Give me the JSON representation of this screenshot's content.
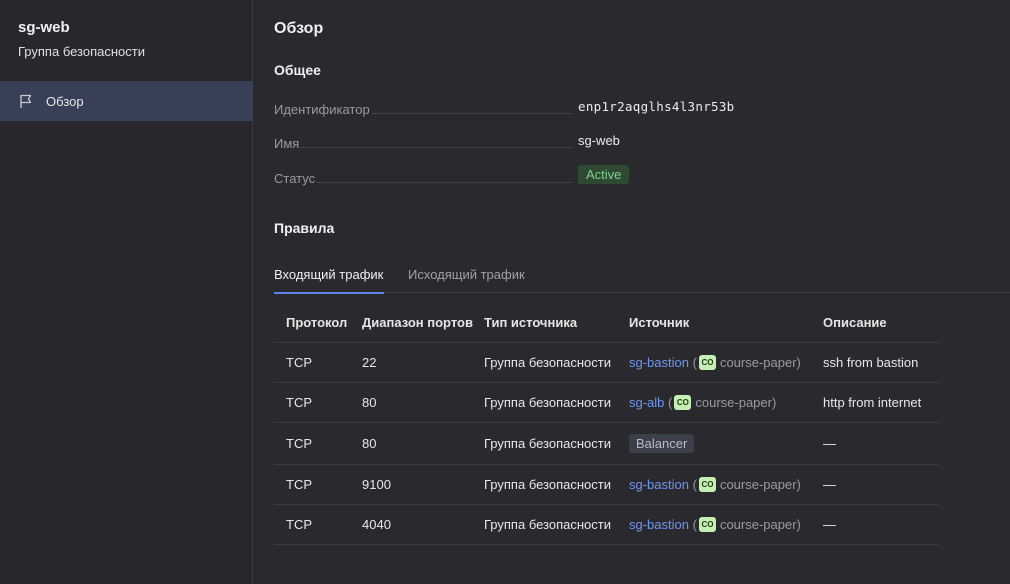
{
  "sidebar": {
    "title": "sg-web",
    "subtitle": "Группа безопасности",
    "items": [
      {
        "label": "Обзор",
        "icon": "flag-icon",
        "active": true
      }
    ]
  },
  "main": {
    "page_title": "Обзор",
    "general": {
      "title": "Общее",
      "id_label": "Идентификатор",
      "id_value": "enp1r2aqglhs4l3nr53b",
      "name_label": "Имя",
      "name_value": "sg-web",
      "status_label": "Статус",
      "status_value": "Active"
    },
    "rules": {
      "title": "Правила",
      "tabs": [
        {
          "label": "Входящий трафик",
          "active": true
        },
        {
          "label": "Исходящий трафик",
          "active": false
        }
      ],
      "columns": [
        "Протокол",
        "Диапазон портов",
        "Тип источника",
        "Источник",
        "Описание"
      ],
      "rows": [
        {
          "protocol": "TCP",
          "ports": "22",
          "source_type": "Группа безопасности",
          "source_link": "sg-bastion",
          "folder_badge": "CO",
          "folder": "course-paper",
          "description": "ssh from bastion"
        },
        {
          "protocol": "TCP",
          "ports": "80",
          "source_type": "Группа безопасности",
          "source_link": "sg-alb",
          "folder_badge": "CO",
          "folder": "course-paper",
          "description": "http from internet"
        },
        {
          "protocol": "TCP",
          "ports": "80",
          "source_type": "Группа безопасности",
          "source_tag": "Balancer",
          "description": "—"
        },
        {
          "protocol": "TCP",
          "ports": "9100",
          "source_type": "Группа безопасности",
          "source_link": "sg-bastion",
          "folder_badge": "CO",
          "folder": "course-paper",
          "description": "—"
        },
        {
          "protocol": "TCP",
          "ports": "4040",
          "source_type": "Группа безопасности",
          "source_link": "sg-bastion",
          "folder_badge": "CO",
          "folder": "course-paper",
          "description": "—"
        }
      ]
    }
  },
  "colors": {
    "background": "#2a2a2e",
    "sidebar_active": "#374057",
    "link": "#6f96f2",
    "tab_underline": "#5b84e6",
    "status_active_bg": "#2f4a33",
    "status_active_text": "#7fd08a",
    "folder_badge_bg": "#c5f0b4"
  }
}
